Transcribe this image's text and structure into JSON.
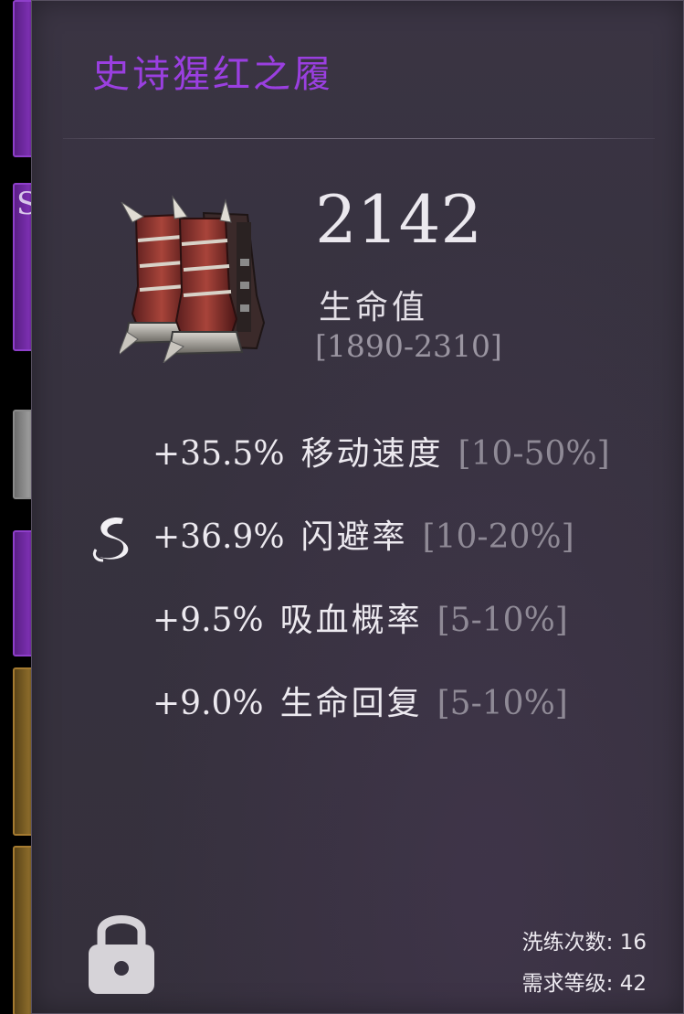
{
  "item": {
    "title": "史诗猩红之履",
    "title_color": "#9a3fe0",
    "icon": "crimson-boots-icon",
    "main_stat": {
      "value": "2142",
      "label": "生命值",
      "range": "[1890-2310]"
    },
    "stats": [
      {
        "value": "+35.5%",
        "name": "移动速度",
        "range": "[10-50%]",
        "special": false
      },
      {
        "value": "+36.9%",
        "name": "闪避率",
        "range": "[10-20%]",
        "special": true,
        "special_icon": "swirl-rune-icon"
      },
      {
        "value": "+9.5%",
        "name": "吸血概率",
        "range": "[5-10%]",
        "special": false
      },
      {
        "value": "+9.0%",
        "name": "生命回复",
        "range": "[5-10%]",
        "special": false
      }
    ],
    "lock_icon": "padlock-icon",
    "footer": {
      "reroll_label": "洗练次数:",
      "reroll_count": "16",
      "level_label": "需求等级:",
      "level_value": "42"
    }
  }
}
